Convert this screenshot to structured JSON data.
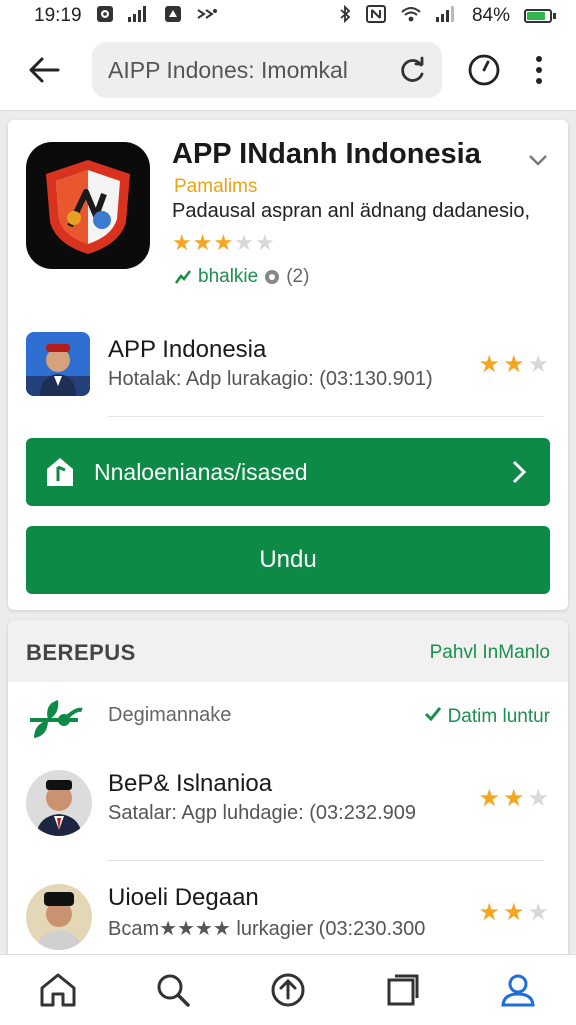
{
  "status_bar": {
    "time": "19:19",
    "battery_text": "84%",
    "battery_level": 0.84
  },
  "toolbar": {
    "url_text": "AIPP Indones: Imomkal"
  },
  "app_card": {
    "title": "APP INdanh Indonesia",
    "developer": "Pamalims",
    "description": "Padausal aspran anl ädnang dadanesio,",
    "rating_stars": 3,
    "rating_max": 5,
    "badge_text": "bhalkie",
    "badge_count": "(2)",
    "related": {
      "title": "APP Indonesia",
      "subtitle": "Hotalak: Adp lurakagio: (03:130.901)",
      "stars": 2,
      "max": 3
    },
    "nav_button_label": "Nnaloenianas/isased",
    "download_label": "Undu"
  },
  "section": {
    "title": "BEREPUS",
    "link": "Pahvl InManlo",
    "sub_label": "Degimannake",
    "check_label": "Datim luntur",
    "rows": [
      {
        "title": "BeP& Islnanioa",
        "subtitle": "Satalar: Agp luhdagie: (03:232.909",
        "stars": 2,
        "max": 3
      },
      {
        "title": "Uioeli Degaan",
        "subtitle": "Bcam★★★★ lurkagier (03:230.300",
        "stars": 2,
        "max": 3
      }
    ]
  },
  "colors": {
    "accent_green": "#0d8a46",
    "star": "#f5a623",
    "nav_active": "#1e6fd9"
  }
}
